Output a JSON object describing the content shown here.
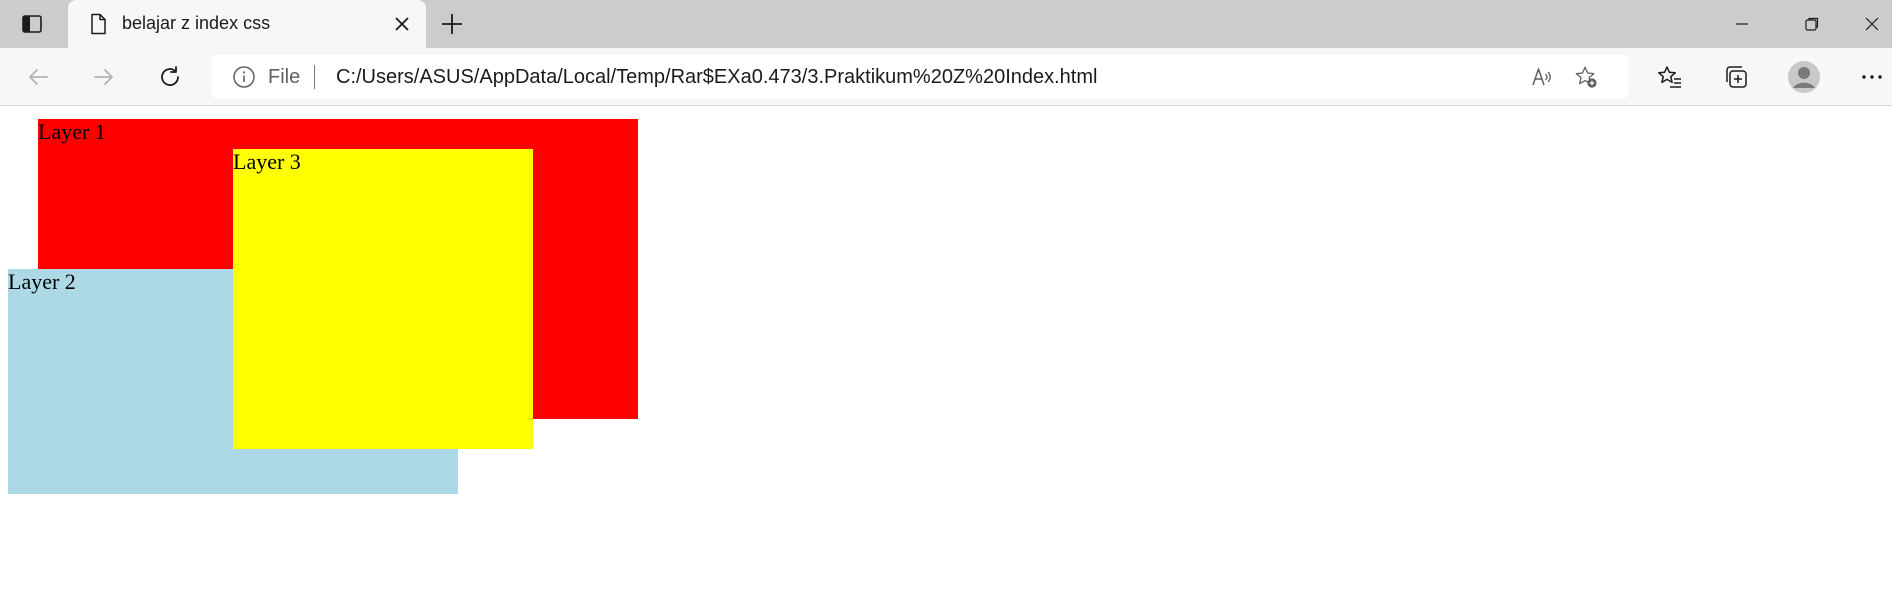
{
  "tab": {
    "title": "belajar z index css",
    "favicon": "page-icon"
  },
  "address_bar": {
    "site_info_label": "File",
    "url": "C:/Users/ASUS/AppData/Local/Temp/Rar$EXa0.473/3.Praktikum%20Z%20Index.html"
  },
  "icons": {
    "tab_actions": "tab-actions-icon",
    "close_tab": "close-icon",
    "new_tab": "plus-icon",
    "back": "back-arrow-icon",
    "forward": "forward-arrow-icon",
    "refresh": "refresh-icon",
    "site_info": "info-icon",
    "read_aloud": "read-aloud-icon",
    "add_favorite": "star-plus-icon",
    "favorites": "favorites-icon",
    "collections": "collections-icon",
    "profile": "profile-icon",
    "menu": "more-icon",
    "minimize": "minimize-icon",
    "restore": "restore-icon",
    "close_window": "close-icon"
  },
  "layers": [
    {
      "label": "Layer 1",
      "color": "#ff0000",
      "z_index": 1
    },
    {
      "label": "Layer 2",
      "color": "#add8e6",
      "z_index": 2
    },
    {
      "label": "Layer 3",
      "color": "#ffff00",
      "z_index": 3
    }
  ],
  "colors": {
    "tabstrip": "#cccccc",
    "toolbar": "#f7f7f7",
    "page_background": "#ffffff"
  }
}
